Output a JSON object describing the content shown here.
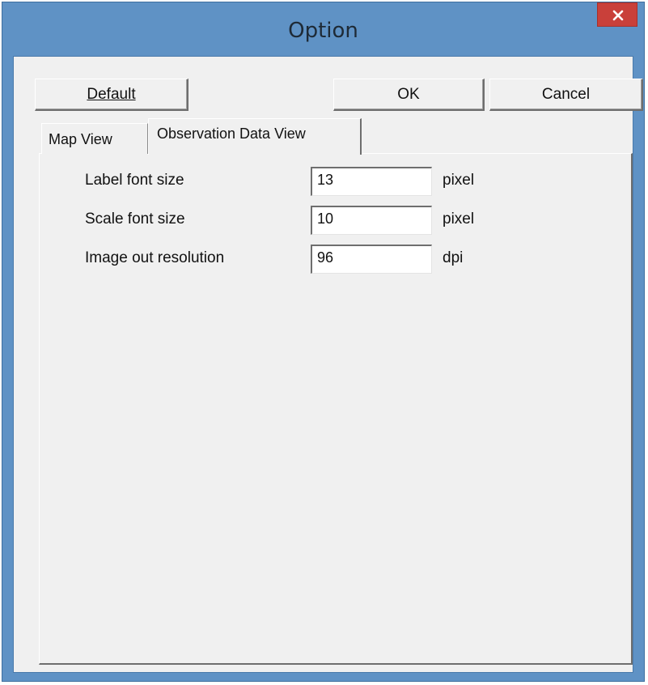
{
  "window": {
    "title": "Option",
    "close_icon": "close-icon"
  },
  "toolbar": {
    "default_label": "Default",
    "ok_label": "OK",
    "cancel_label": "Cancel"
  },
  "tabs": [
    {
      "label": "Map View",
      "active": false
    },
    {
      "label": "Observation Data View",
      "active": true
    }
  ],
  "settings": [
    {
      "label": "Label font size",
      "value": "13",
      "unit": "pixel"
    },
    {
      "label": "Scale font size",
      "value": "10",
      "unit": "pixel"
    },
    {
      "label": "Image out resolution",
      "value": "96",
      "unit": "dpi"
    }
  ],
  "colors": {
    "title_bar": "#5f92c5",
    "close_button": "#c9403a",
    "client_bg": "#f0f0f0"
  }
}
